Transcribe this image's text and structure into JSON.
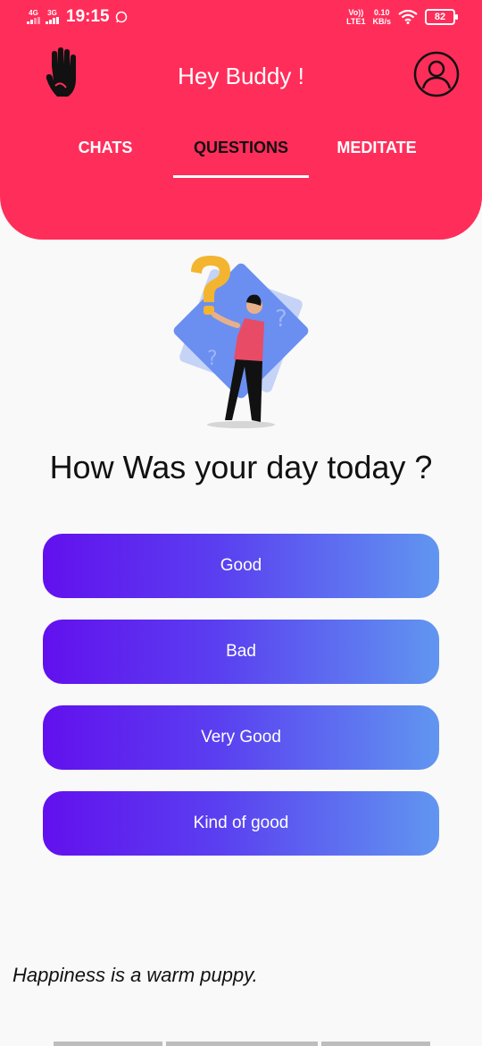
{
  "status": {
    "sim1_label": "4G",
    "sim2_label": "3G",
    "time": "19:15",
    "network_line1": "Vo))",
    "network_line2": "LTE1",
    "speed_value": "0.10",
    "speed_unit": "KB/s",
    "battery": "82"
  },
  "header": {
    "title": "Hey Buddy !",
    "logo_icon": "raised-hand-icon",
    "profile_icon": "user-circle-icon"
  },
  "tabs": [
    {
      "label": "CHATS"
    },
    {
      "label": "QUESTIONS",
      "active": true
    },
    {
      "label": "MEDITATE"
    }
  ],
  "question": {
    "text": "How Was your day today ?"
  },
  "answers": [
    {
      "label": "Good"
    },
    {
      "label": "Bad"
    },
    {
      "label": "Very Good"
    },
    {
      "label": "Kind of good"
    }
  ],
  "quote": "Happiness is a warm puppy.",
  "colors": {
    "header": "#ff2d5a",
    "gradient_start": "#6210ee",
    "gradient_end": "#6196f0",
    "background": "#f9f9f9"
  }
}
